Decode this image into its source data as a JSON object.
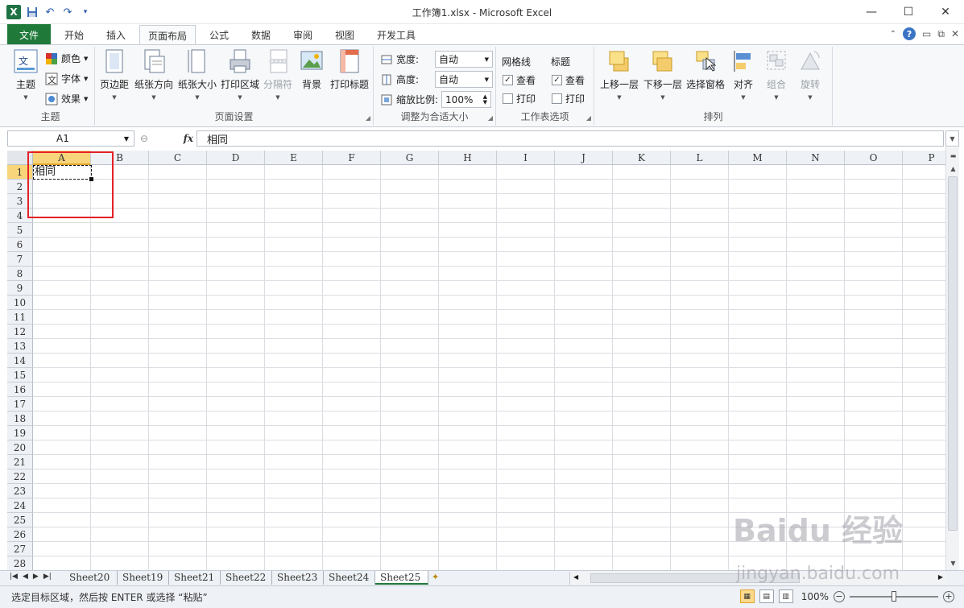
{
  "window": {
    "title": "工作簿1.xlsx - Microsoft Excel",
    "logo": "X",
    "minimize": "—",
    "maximize": "☐",
    "close": "✕"
  },
  "menu": {
    "file": "文件",
    "tabs": [
      "开始",
      "插入",
      "页面布局",
      "公式",
      "数据",
      "审阅",
      "视图",
      "开发工具"
    ],
    "active": "页面布局",
    "help": "?"
  },
  "ribbon": {
    "themes": {
      "label": "主题",
      "theme_btn": "主题",
      "colors": "颜色",
      "fonts": "字体",
      "effects": "效果"
    },
    "page_setup": {
      "label": "页面设置",
      "margins": "页边距",
      "orientation": "纸张方向",
      "size": "纸张大小",
      "print_area": "打印区域",
      "breaks": "分隔符",
      "background": "背景",
      "print_titles": "打印标题"
    },
    "scale_to_fit": {
      "label": "调整为合适大小",
      "width_label": "宽度:",
      "width_value": "自动",
      "height_label": "高度:",
      "height_value": "自动",
      "scale_label": "缩放比例:",
      "scale_value": "100%"
    },
    "sheet_options": {
      "label": "工作表选项",
      "gridlines": "网格线",
      "headings": "标题",
      "view": "查看",
      "print": "打印"
    },
    "arrange": {
      "label": "排列",
      "bring_forward": "上移一层",
      "send_backward": "下移一层",
      "selection_pane": "选择窗格",
      "align": "对齐",
      "group": "组合",
      "rotate": "旋转"
    }
  },
  "formula_bar": {
    "name_box": "A1",
    "fx": "fx",
    "content": "相同"
  },
  "columns": [
    "A",
    "B",
    "C",
    "D",
    "E",
    "F",
    "G",
    "H",
    "I",
    "J",
    "K",
    "L",
    "M",
    "N",
    "O",
    "P"
  ],
  "rows": [
    "1",
    "2",
    "3",
    "4",
    "5",
    "6",
    "7",
    "8",
    "9",
    "10",
    "11",
    "12",
    "13",
    "14",
    "15",
    "16",
    "17",
    "18",
    "19",
    "20",
    "21",
    "22",
    "23",
    "24",
    "25",
    "26",
    "27",
    "28"
  ],
  "cells": {
    "A1": "相同"
  },
  "sheets": [
    "Sheet20",
    "Sheet19",
    "Sheet21",
    "Sheet22",
    "Sheet23",
    "Sheet24",
    "Sheet25"
  ],
  "active_sheet": "Sheet25",
  "status": {
    "message": "选定目标区域，然后按 ENTER 或选择 “粘贴”",
    "zoom": "100%"
  },
  "watermark": {
    "logo": "Baidu 经验",
    "url": "jingyan.baidu.com"
  },
  "colors": {
    "file_tab": "#1f7a3a",
    "selection_header": "#f8d57a",
    "highlight_box": "#e52026"
  }
}
